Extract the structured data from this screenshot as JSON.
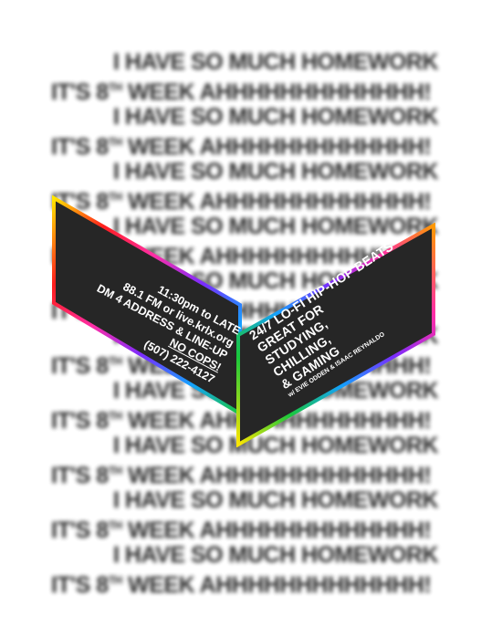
{
  "background": {
    "line_homework": "I HAVE SO MUCH HOMEWORK",
    "line_week_prefix": "IT'S 8",
    "line_week_sup": "TH",
    "line_week_suffix": " WEEK AHHHHHHHHHHHHH!"
  },
  "left_panel": {
    "time": "11:30pm to LATE",
    "station": "88.1 FM or live.krlx.org",
    "dm": "DM 4 ADDRESS & LINE-UP",
    "no_cops": "NO COPS!",
    "phone": "(507) 222-4127"
  },
  "right_panel": {
    "line1": "24/7 LO-FI HIP-HOP BEATS",
    "line2": "GREAT FOR",
    "line3": "STUDYING,",
    "line4": "CHILLING,",
    "line5": "& GAMING",
    "credit": "w/ EVIE ODDEN & ISAAC REYNALDO"
  },
  "colors": {
    "panel": "#262626",
    "text": "#ffffff",
    "border_gradient": [
      "#ff1e1e",
      "#ff9a00",
      "#ffe600",
      "#19c83c",
      "#14a0ff",
      "#7a2cff",
      "#ff2ea6"
    ]
  }
}
